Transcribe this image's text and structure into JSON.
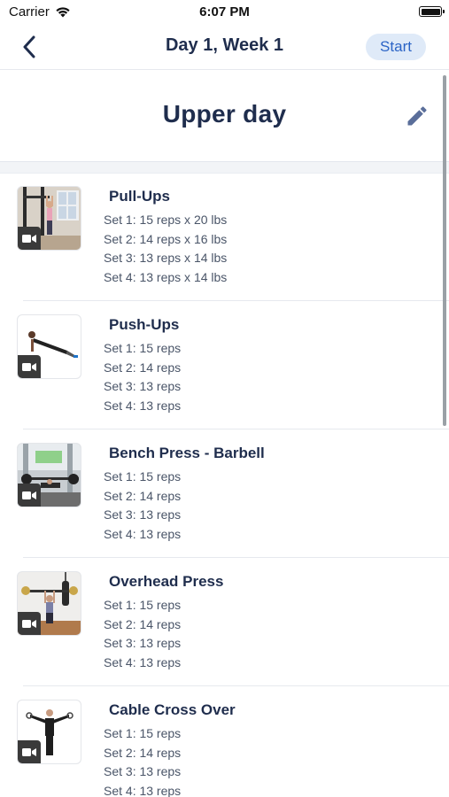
{
  "status_bar": {
    "carrier": "Carrier",
    "time": "6:07 PM",
    "battery_level": 1.0
  },
  "nav": {
    "title": "Day 1, Week 1",
    "start_label": "Start",
    "back_icon": "chevron-left-icon",
    "accent_color": "#2b64c6",
    "start_bg": "#dfeaf8"
  },
  "header": {
    "title": "Upper day",
    "edit_icon": "pencil-icon"
  },
  "exercises": [
    {
      "name": "Pull-Ups",
      "thumb": "pull-ups-photo",
      "sets": [
        "Set 1: 15 reps x 20 lbs",
        "Set 2: 14 reps x 16 lbs",
        "Set 3: 13 reps x 14 lbs",
        "Set 4: 13 reps x 14 lbs"
      ]
    },
    {
      "name": "Push-Ups",
      "thumb": "push-ups-photo",
      "sets": [
        "Set 1: 15 reps",
        "Set 2: 14 reps",
        "Set 3: 13 reps",
        "Set 4: 13 reps"
      ]
    },
    {
      "name": "Bench Press - Barbell",
      "thumb": "bench-press-photo",
      "sets": [
        "Set 1: 15 reps",
        "Set 2: 14 reps",
        "Set 3: 13 reps",
        "Set 4: 13 reps"
      ]
    },
    {
      "name": "Overhead Press",
      "thumb": "overhead-press-photo",
      "sets": [
        "Set 1: 15 reps",
        "Set 2: 14 reps",
        "Set 3: 13 reps",
        "Set 4: 13 reps"
      ]
    },
    {
      "name": "Cable Cross Over",
      "thumb": "cable-cross-over-photo",
      "sets": [
        "Set 1: 15 reps",
        "Set 2: 14 reps",
        "Set 3: 13 reps",
        "Set 4: 13 reps"
      ]
    }
  ]
}
